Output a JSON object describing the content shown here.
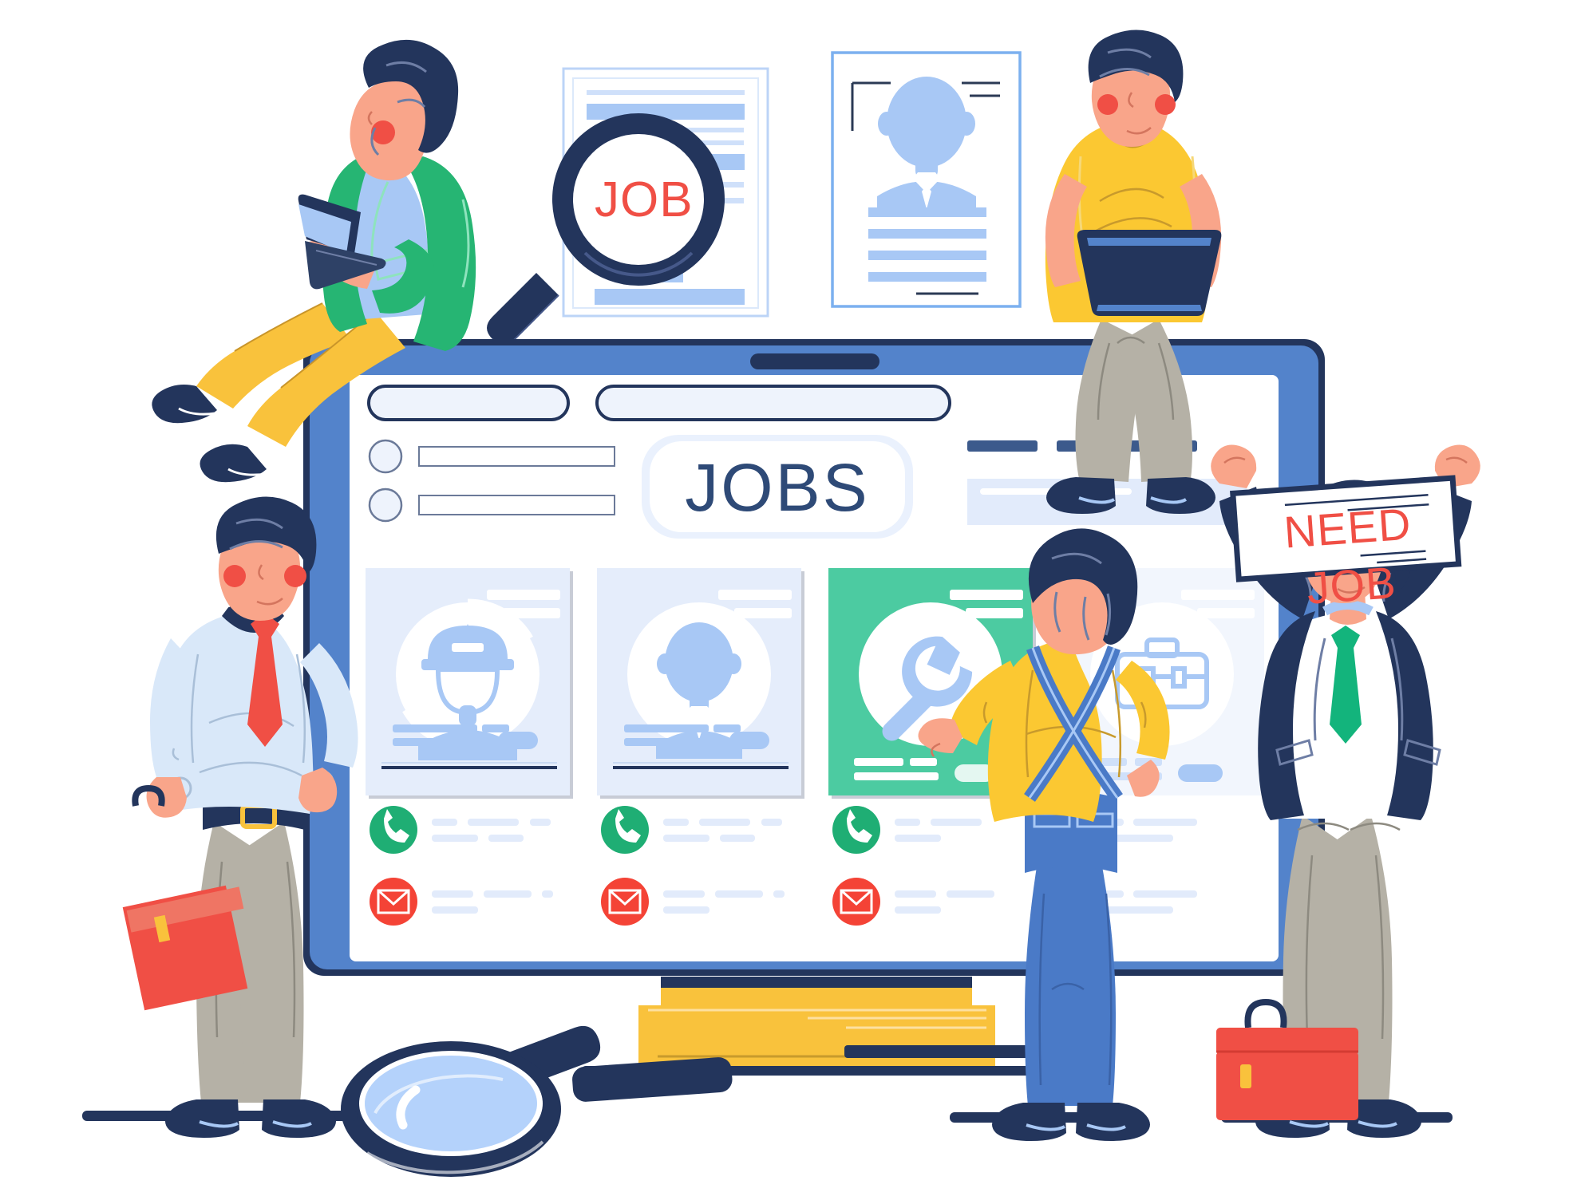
{
  "scene": {
    "title": "Job search illustration",
    "background": "#ffffff"
  },
  "palette": {
    "navy": "#23355c",
    "navy_dark": "#1d2b4f",
    "blue": "#4a7ac7",
    "blue_mid": "#5383cb",
    "blue_light": "#a8c8f5",
    "blue_pale": "#e5edfb",
    "blue_paler": "#f2f6fd",
    "green": "#2fba83",
    "green_mint": "#4ccba1",
    "green_jacket": "#26b573",
    "red": "#f04f45",
    "red_soft": "#ef5350",
    "yellow": "#f9c23c",
    "yellow_shirt": "#fbc832",
    "skin": "#f9a58a",
    "skin_light": "#fbb9a0",
    "khaki": "#b8b3a4",
    "grey": "#b5b1a6",
    "white": "#ffffff"
  },
  "magnifier_badge": {
    "label": "JOB",
    "color": "#f04f45"
  },
  "screen": {
    "heading": "JOBS",
    "heading_color": "#2e4a77",
    "search_fields": [
      {
        "name": "primary-search",
        "value": "",
        "placeholder": ""
      },
      {
        "name": "secondary-search",
        "value": "",
        "placeholder": ""
      }
    ],
    "filters": [
      {
        "name": "filter-option-1",
        "selected": false,
        "label": ""
      },
      {
        "name": "filter-option-2",
        "selected": false,
        "label": ""
      }
    ],
    "cards": [
      {
        "id": "card-hardhat",
        "icon": "hardhat-worker-icon",
        "highlighted": false,
        "bg": "#e5edfb",
        "contact": {
          "phone_icon": "phone-icon",
          "mail_icon": "mail-icon"
        }
      },
      {
        "id": "card-person",
        "icon": "person-avatar-icon",
        "highlighted": false,
        "bg": "#e5edfb",
        "contact": {
          "phone_icon": "phone-icon",
          "mail_icon": "mail-icon"
        }
      },
      {
        "id": "card-wrench",
        "icon": "wrench-icon",
        "highlighted": true,
        "bg": "#4ccba1",
        "contact": {
          "phone_icon": "phone-icon",
          "mail_icon": "mail-icon"
        }
      },
      {
        "id": "card-briefcase",
        "icon": "briefcase-icon",
        "highlighted": false,
        "bg": "#f2f6fd",
        "contact": {
          "phone_icon": "",
          "mail_icon": ""
        }
      }
    ]
  },
  "documents": {
    "job_listing": {
      "name": "job-listing-document",
      "lines": 8
    },
    "resume": {
      "name": "resume-document",
      "avatar": "person-avatar-icon",
      "lines": 4
    }
  },
  "sign": {
    "label": "NEED JOB",
    "color": "#f04f45",
    "border": "#23355c"
  },
  "characters": [
    {
      "name": "woman-with-laptop-sitting",
      "top": "green jacket",
      "bottom": "yellow trousers"
    },
    {
      "name": "man-with-laptop-sitting",
      "top": "yellow t-shirt",
      "bottom": "grey trousers"
    },
    {
      "name": "businessman-with-briefcase",
      "top": "light blue shirt, red tie",
      "bottom": "khaki trousers"
    },
    {
      "name": "worker-in-overalls",
      "top": "yellow t-shirt",
      "bottom": "blue overalls"
    },
    {
      "name": "woman-holding-need-job-sign",
      "top": "navy blazer, green tie",
      "bottom": "khaki trousers"
    }
  ],
  "props": [
    {
      "name": "large-magnifier-icon"
    },
    {
      "name": "small-magnifier-icon"
    },
    {
      "name": "red-briefcase-prop"
    },
    {
      "name": "red-toolbox-prop"
    },
    {
      "name": "monitor-stand"
    }
  ]
}
